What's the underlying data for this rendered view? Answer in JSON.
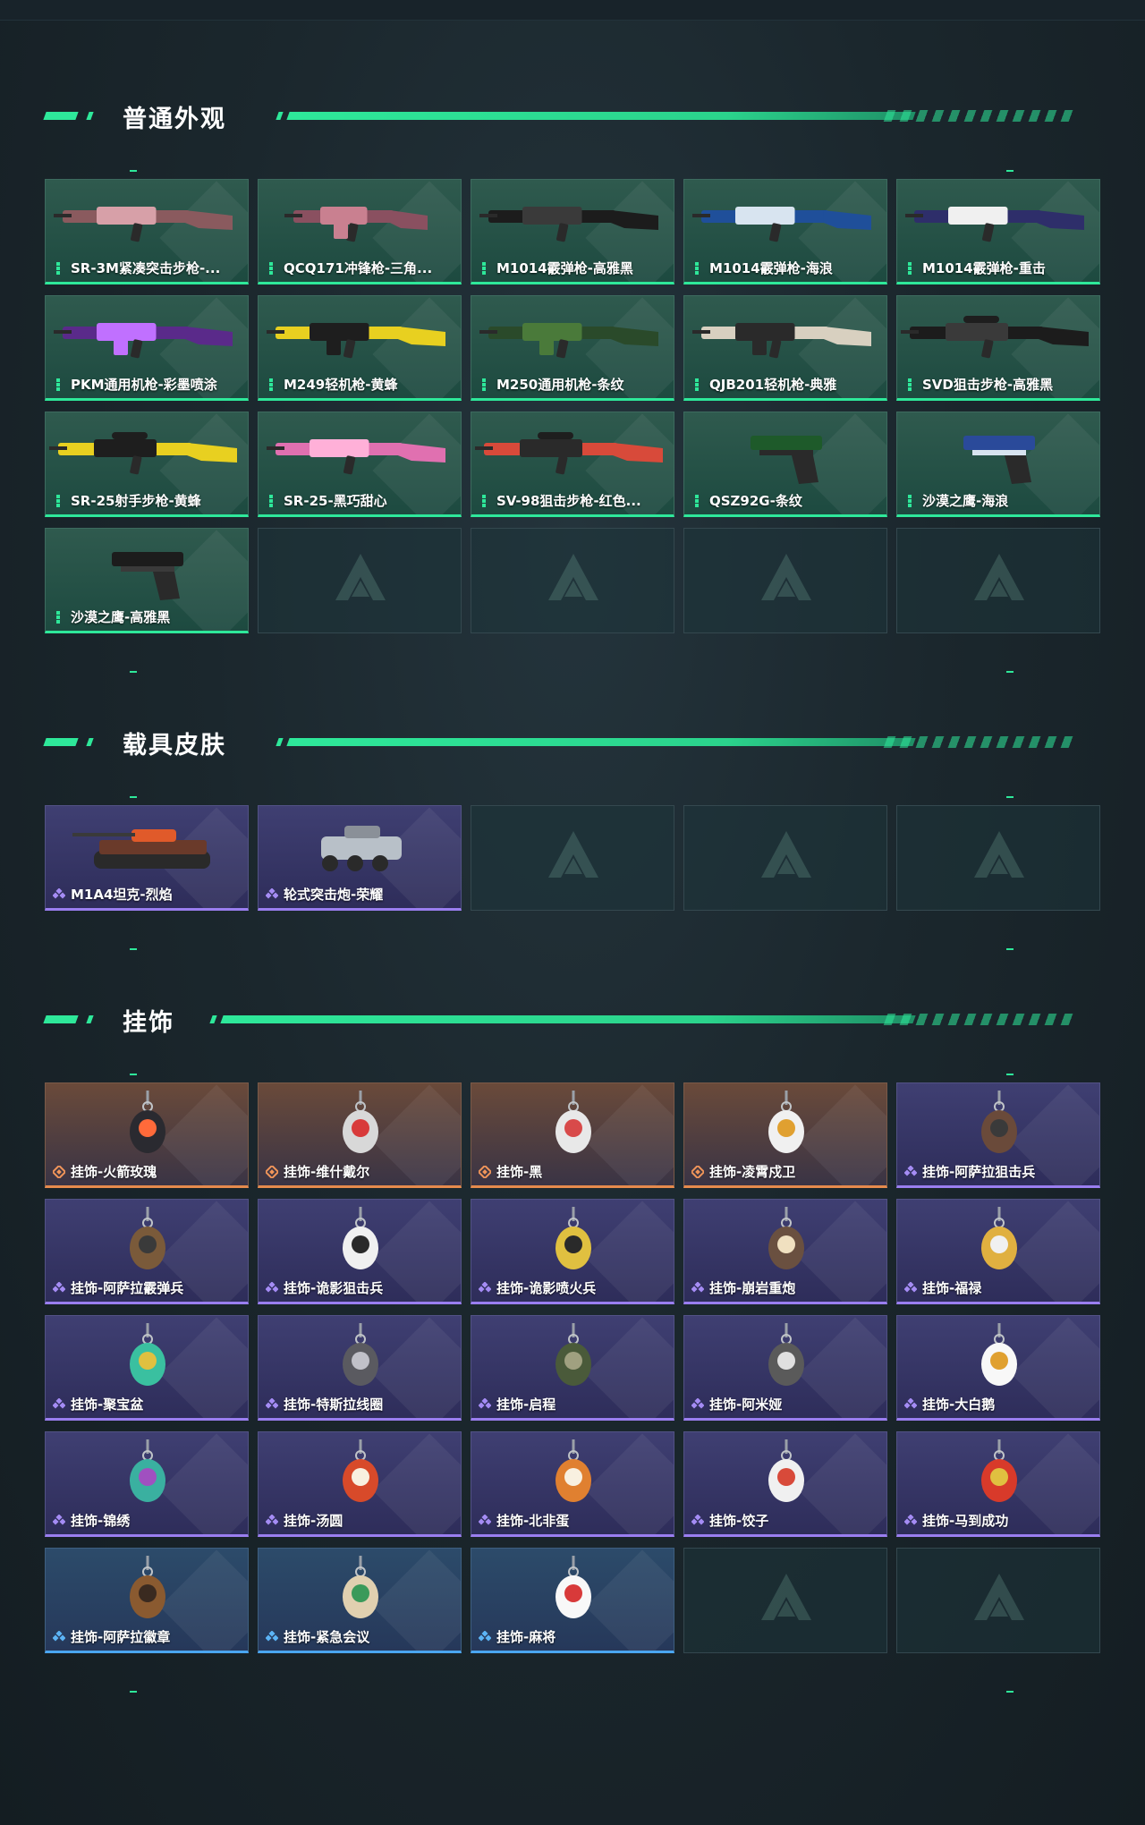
{
  "sections": [
    {
      "title": "普通外观",
      "items": [
        {
          "label": "SR-3M紧凑突击步枪-...",
          "rarity": "green",
          "icon": "rifle-icon",
          "colors": [
            "#8a5a5e",
            "#d7a0a8"
          ]
        },
        {
          "label": "QCQ171冲锋枪-三角...",
          "rarity": "green",
          "icon": "smg-icon",
          "colors": [
            "#8a5060",
            "#c98090"
          ]
        },
        {
          "label": "M1014霰弹枪-高雅黑",
          "rarity": "green",
          "icon": "shotgun-icon",
          "colors": [
            "#1c1c1c",
            "#3a3a3a"
          ]
        },
        {
          "label": "M1014霰弹枪-海浪",
          "rarity": "green",
          "icon": "shotgun-icon",
          "colors": [
            "#1f4f9a",
            "#d8e4f0"
          ]
        },
        {
          "label": "M1014霰弹枪-重击",
          "rarity": "green",
          "icon": "shotgun-icon",
          "colors": [
            "#2e2e6a",
            "#f0f0f0"
          ]
        },
        {
          "label": "PKM通用机枪-彩墨喷涂",
          "rarity": "green",
          "icon": "machine-gun-icon",
          "colors": [
            "#5a2a8a",
            "#c070ff"
          ]
        },
        {
          "label": "M249轻机枪-黄蜂",
          "rarity": "green",
          "icon": "machine-gun-icon",
          "colors": [
            "#e8d020",
            "#1e1e1e"
          ]
        },
        {
          "label": "M250通用机枪-条纹",
          "rarity": "green",
          "icon": "machine-gun-icon",
          "colors": [
            "#2a4a2a",
            "#4a7a3a"
          ]
        },
        {
          "label": "QJB201轻机枪-典雅",
          "rarity": "green",
          "icon": "machine-gun-icon",
          "colors": [
            "#d8d0c0",
            "#2a2a2a"
          ]
        },
        {
          "label": "SVD狙击步枪-高雅黑",
          "rarity": "green",
          "icon": "sniper-icon",
          "colors": [
            "#1c1c1c",
            "#3a3a3a"
          ]
        },
        {
          "label": "SR-25射手步枪-黄蜂",
          "rarity": "green",
          "icon": "sniper-icon",
          "colors": [
            "#e8d020",
            "#1e1e1e"
          ]
        },
        {
          "label": "SR-25-黑巧甜心",
          "rarity": "green",
          "icon": "rifle-icon",
          "colors": [
            "#e070b0",
            "#ffb0d8"
          ]
        },
        {
          "label": "SV-98狙击步枪-红色...",
          "rarity": "green",
          "icon": "sniper-icon",
          "colors": [
            "#d84a3a",
            "#2a2a2a"
          ]
        },
        {
          "label": "QSZ92G-条纹",
          "rarity": "green",
          "icon": "pistol-icon",
          "colors": [
            "#1e5a2a",
            "#2a2a2a"
          ]
        },
        {
          "label": "沙漠之鹰-海浪",
          "rarity": "green",
          "icon": "pistol-icon",
          "colors": [
            "#2a4a9a",
            "#d8e4f0"
          ]
        },
        {
          "label": "沙漠之鹰-高雅黑",
          "rarity": "green",
          "icon": "pistol-icon",
          "colors": [
            "#1c1c1c",
            "#3a3a3a"
          ]
        },
        {
          "empty": true
        },
        {
          "empty": true
        },
        {
          "empty": true
        },
        {
          "empty": true
        }
      ]
    },
    {
      "title": "载具皮肤",
      "items": [
        {
          "label": "M1A4坦克-烈焰",
          "rarity": "purple",
          "icon": "tank-icon",
          "colors": [
            "#6a3a2a",
            "#e05a2a"
          ]
        },
        {
          "label": "轮式突击炮-荣耀",
          "rarity": "purple",
          "icon": "armored-car-icon",
          "colors": [
            "#b8c0c8",
            "#2a2a2a"
          ]
        },
        {
          "empty": true
        },
        {
          "empty": true
        },
        {
          "empty": true
        }
      ]
    },
    {
      "title": "挂饰",
      "items": [
        {
          "label": "挂饰-火箭玫瑰",
          "rarity": "orange",
          "icon": "charm-icon",
          "colors": [
            "#2a2a30",
            "#ff6a3a"
          ]
        },
        {
          "label": "挂饰-维什戴尔",
          "rarity": "orange",
          "icon": "charm-icon",
          "colors": [
            "#d8d8d8",
            "#d83a3a"
          ]
        },
        {
          "label": "挂饰-黑",
          "rarity": "orange",
          "icon": "charm-icon",
          "colors": [
            "#e8e8e8",
            "#d84a4a"
          ]
        },
        {
          "label": "挂饰-凌霄戍卫",
          "rarity": "orange",
          "icon": "charm-icon",
          "colors": [
            "#f0f0f0",
            "#e0a030"
          ]
        },
        {
          "label": "挂饰-阿萨拉狙击兵",
          "rarity": "purple",
          "icon": "charm-icon",
          "colors": [
            "#6a4a3a",
            "#3a3a3a"
          ]
        },
        {
          "label": "挂饰-阿萨拉霰弹兵",
          "rarity": "purple",
          "icon": "charm-icon",
          "colors": [
            "#7a5a3a",
            "#3a3a3a"
          ]
        },
        {
          "label": "挂饰-诡影狙击兵",
          "rarity": "purple",
          "icon": "charm-icon",
          "colors": [
            "#f0f0f0",
            "#2a2a2a"
          ]
        },
        {
          "label": "挂饰-诡影喷火兵",
          "rarity": "purple",
          "icon": "charm-icon",
          "colors": [
            "#e0c040",
            "#2a2a2a"
          ]
        },
        {
          "label": "挂饰-崩岩重炮",
          "rarity": "purple",
          "icon": "charm-icon",
          "colors": [
            "#6a5040",
            "#f0e0c0"
          ]
        },
        {
          "label": "挂饰-福禄",
          "rarity": "purple",
          "icon": "charm-icon",
          "colors": [
            "#e0b040",
            "#f0f0f0"
          ]
        },
        {
          "label": "挂饰-聚宝盆",
          "rarity": "purple",
          "icon": "charm-icon",
          "colors": [
            "#3ac0a0",
            "#e0c040"
          ]
        },
        {
          "label": "挂饰-特斯拉线圈",
          "rarity": "purple",
          "icon": "charm-icon",
          "colors": [
            "#5a5a60",
            "#c0c0c8"
          ]
        },
        {
          "label": "挂饰-启程",
          "rarity": "purple",
          "icon": "charm-icon",
          "colors": [
            "#4a5a3a",
            "#a0a080"
          ]
        },
        {
          "label": "挂饰-阿米娅",
          "rarity": "purple",
          "icon": "charm-icon",
          "colors": [
            "#5a5a5a",
            "#e0e0e0"
          ]
        },
        {
          "label": "挂饰-大白鹅",
          "rarity": "purple",
          "icon": "charm-icon",
          "colors": [
            "#f8f8f8",
            "#e0a030"
          ]
        },
        {
          "label": "挂饰-锦绣",
          "rarity": "purple",
          "icon": "charm-icon",
          "colors": [
            "#3ab0a0",
            "#a050c0"
          ]
        },
        {
          "label": "挂饰-汤圆",
          "rarity": "purple",
          "icon": "charm-icon",
          "colors": [
            "#d84a2a",
            "#f8f0e0"
          ]
        },
        {
          "label": "挂饰-北非蛋",
          "rarity": "purple",
          "icon": "charm-icon",
          "colors": [
            "#e08030",
            "#f8f0e0"
          ]
        },
        {
          "label": "挂饰-饺子",
          "rarity": "purple",
          "icon": "charm-icon",
          "colors": [
            "#f0f0f0",
            "#d84a3a"
          ]
        },
        {
          "label": "挂饰-马到成功",
          "rarity": "purple",
          "icon": "charm-icon",
          "colors": [
            "#d83a2a",
            "#e0c040"
          ]
        },
        {
          "label": "挂饰-阿萨拉徽章",
          "rarity": "blue",
          "icon": "charm-icon",
          "colors": [
            "#8a5a30",
            "#3a2a20"
          ]
        },
        {
          "label": "挂饰-紧急会议",
          "rarity": "blue",
          "icon": "charm-icon",
          "colors": [
            "#e0d0b0",
            "#3a9a5a"
          ]
        },
        {
          "label": "挂饰-麻将",
          "rarity": "blue",
          "icon": "charm-icon",
          "colors": [
            "#f8f8f8",
            "#d83a3a"
          ]
        },
        {
          "empty": true
        },
        {
          "empty": true
        }
      ]
    }
  ]
}
